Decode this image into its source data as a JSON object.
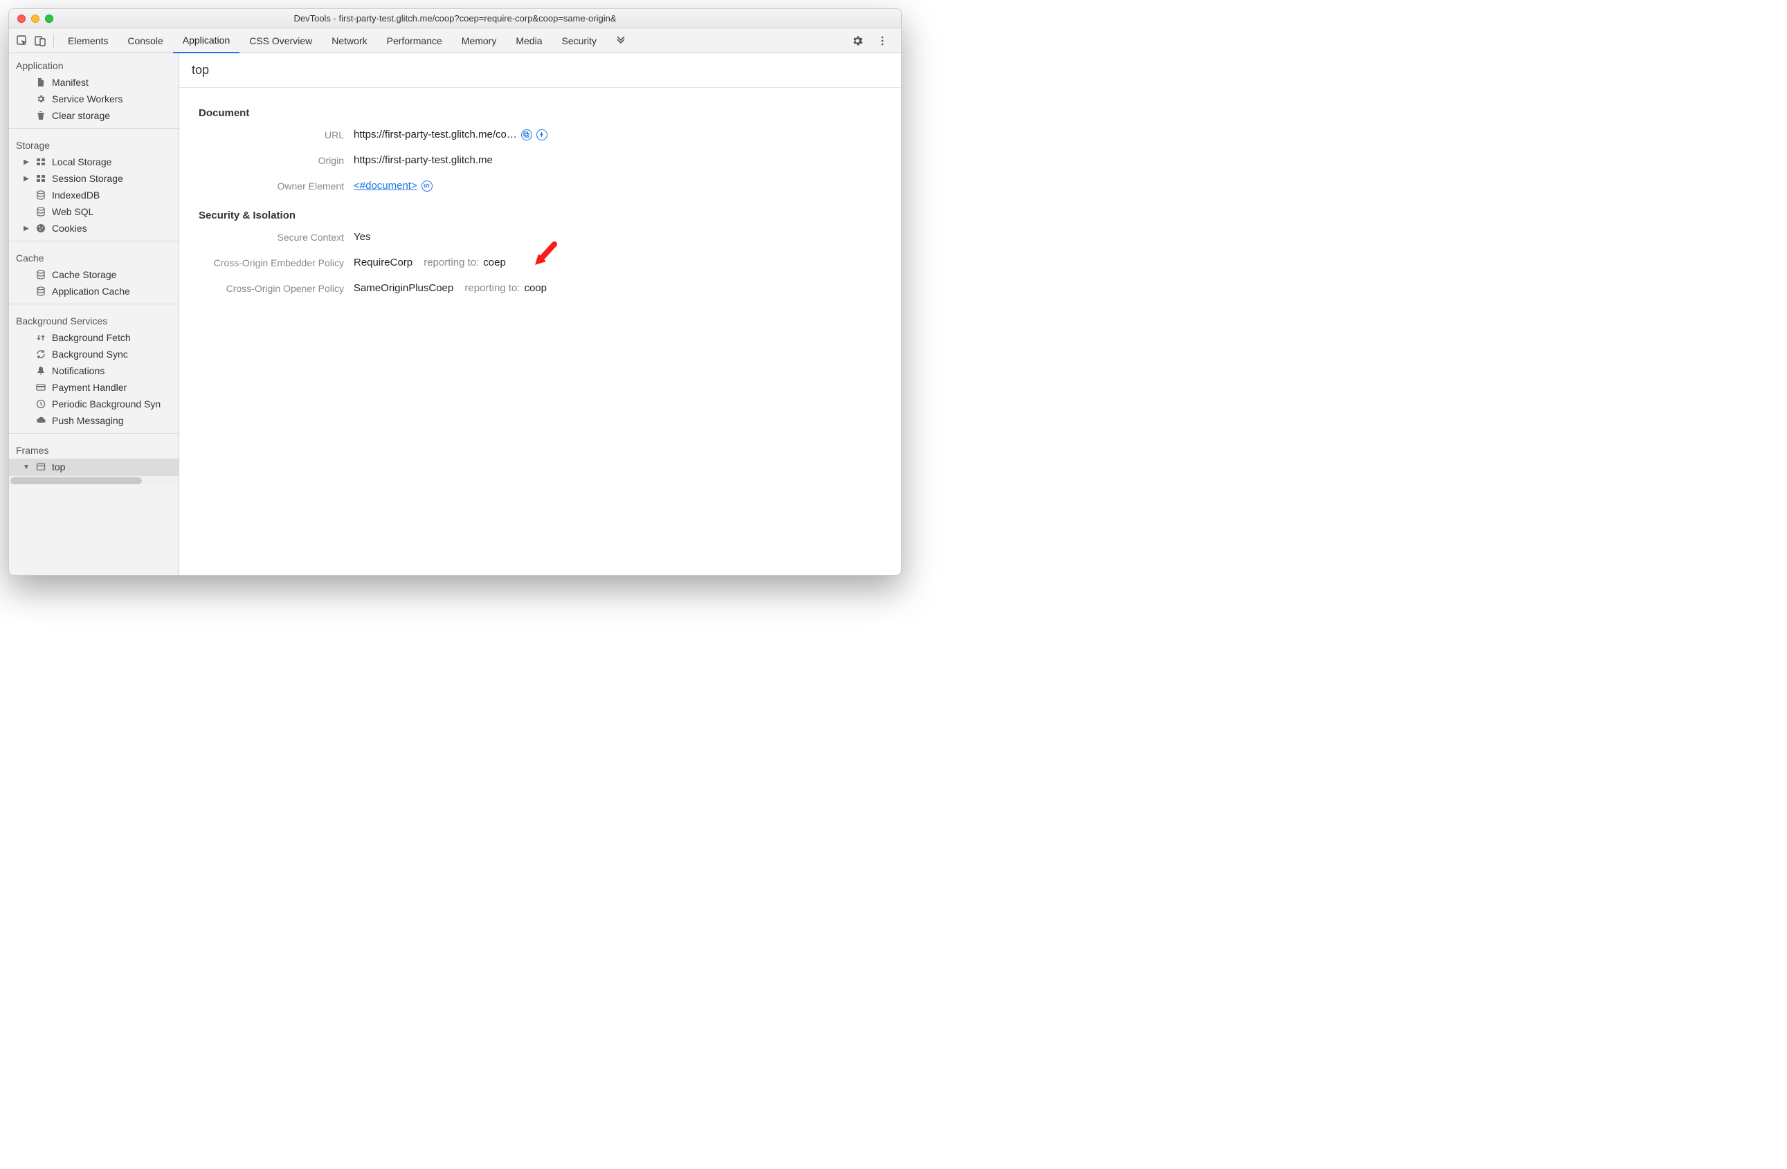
{
  "window": {
    "title": "DevTools - first-party-test.glitch.me/coop?coep=require-corp&coop=same-origin&"
  },
  "tabs": {
    "items": [
      "Elements",
      "Console",
      "Application",
      "CSS Overview",
      "Network",
      "Performance",
      "Memory",
      "Media",
      "Security"
    ],
    "active_index": 2
  },
  "sidebar": {
    "groups": [
      {
        "label": "Application",
        "items": [
          {
            "label": "Manifest",
            "icon": "file-icon"
          },
          {
            "label": "Service Workers",
            "icon": "gear-icon"
          },
          {
            "label": "Clear storage",
            "icon": "trash-icon"
          }
        ]
      },
      {
        "label": "Storage",
        "items": [
          {
            "label": "Local Storage",
            "icon": "grid-icon",
            "expandable": true
          },
          {
            "label": "Session Storage",
            "icon": "grid-icon",
            "expandable": true
          },
          {
            "label": "IndexedDB",
            "icon": "db-icon"
          },
          {
            "label": "Web SQL",
            "icon": "db-icon"
          },
          {
            "label": "Cookies",
            "icon": "cookie-icon",
            "expandable": true
          }
        ]
      },
      {
        "label": "Cache",
        "items": [
          {
            "label": "Cache Storage",
            "icon": "db-icon"
          },
          {
            "label": "Application Cache",
            "icon": "db-icon"
          }
        ]
      },
      {
        "label": "Background Services",
        "items": [
          {
            "label": "Background Fetch",
            "icon": "swap-icon"
          },
          {
            "label": "Background Sync",
            "icon": "sync-icon"
          },
          {
            "label": "Notifications",
            "icon": "bell-icon"
          },
          {
            "label": "Payment Handler",
            "icon": "card-icon"
          },
          {
            "label": "Periodic Background Syn",
            "icon": "clock-icon"
          },
          {
            "label": "Push Messaging",
            "icon": "cloud-icon"
          }
        ]
      },
      {
        "label": "Frames",
        "items": [
          {
            "label": "top",
            "icon": "window-icon",
            "expandable": true,
            "expanded": true,
            "selected": true
          }
        ]
      }
    ]
  },
  "main": {
    "heading": "top",
    "document": {
      "section_label": "Document",
      "url_label": "URL",
      "url_value": "https://first-party-test.glitch.me/co…",
      "origin_label": "Origin",
      "origin_value": "https://first-party-test.glitch.me",
      "owner_label": "Owner Element",
      "owner_value": "<#document>"
    },
    "security": {
      "section_label": "Security & Isolation",
      "secure_context_label": "Secure Context",
      "secure_context_value": "Yes",
      "coep_label": "Cross-Origin Embedder Policy",
      "coep_value": "RequireCorp",
      "coep_reporting_label": "reporting to:",
      "coep_reporting_value": "coep",
      "coop_label": "Cross-Origin Opener Policy",
      "coop_value": "SameOriginPlusCoep",
      "coop_reporting_label": "reporting to:",
      "coop_reporting_value": "coop"
    }
  }
}
